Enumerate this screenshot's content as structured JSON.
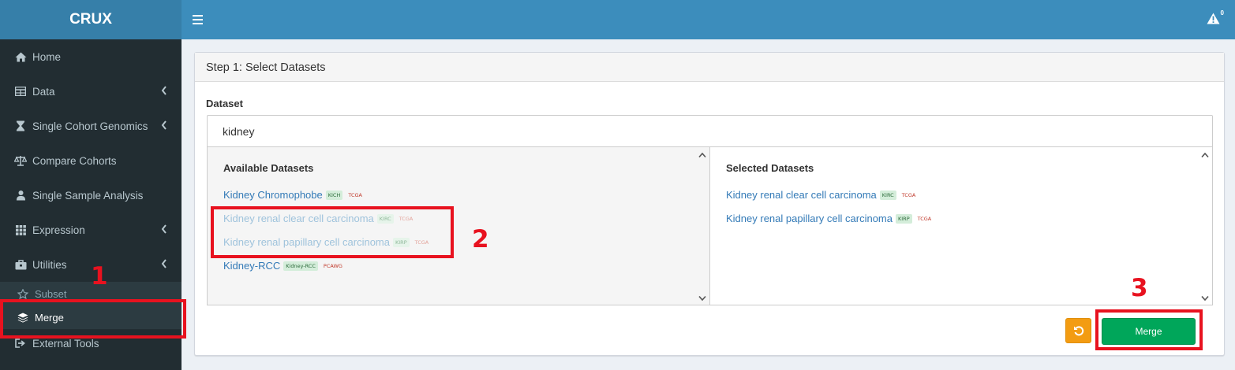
{
  "app": {
    "title": "CRUX",
    "alert_count": "0"
  },
  "sidebar": {
    "items": [
      {
        "label": "Home",
        "icon": "home-icon"
      },
      {
        "label": "Data",
        "icon": "table-icon"
      },
      {
        "label": "Single Cohort Genomics",
        "icon": "hourglass-icon"
      },
      {
        "label": "Compare Cohorts",
        "icon": "balance-scale-icon"
      },
      {
        "label": "Single Sample Analysis",
        "icon": "user-icon"
      },
      {
        "label": "Expression",
        "icon": "grid-icon"
      },
      {
        "label": "Utilities",
        "icon": "toolbox-icon"
      }
    ],
    "utilities_sub": [
      {
        "label": "Subset",
        "icon": "star-icon"
      },
      {
        "label": "Merge",
        "icon": "layers-icon"
      }
    ],
    "external": {
      "label": "External Tools",
      "icon": "sign-out-icon"
    }
  },
  "main": {
    "box_title": "Step 1: Select Datasets",
    "dataset_label": "Dataset",
    "search_value": "kidney",
    "available_title": "Available Datasets",
    "selected_title": "Selected Datasets",
    "available": [
      {
        "name": "Kidney Chromophobe",
        "code": "KICH",
        "source": "TCGA",
        "dimmed": false
      },
      {
        "name": "Kidney renal clear cell carcinoma",
        "code": "KIRC",
        "source": "TCGA",
        "dimmed": true
      },
      {
        "name": "Kidney renal papillary cell carcinoma",
        "code": "KIRP",
        "source": "TCGA",
        "dimmed": true
      },
      {
        "name": "Kidney-RCC",
        "code": "Kidney-RCC",
        "source": "PCAWG",
        "dimmed": false
      }
    ],
    "selected": [
      {
        "name": "Kidney renal clear cell carcinoma",
        "code": "KIRC",
        "source": "TCGA"
      },
      {
        "name": "Kidney renal papillary cell carcinoma",
        "code": "KIRP",
        "source": "TCGA"
      }
    ],
    "merge_label": "Merge"
  },
  "annotations": {
    "one": "1",
    "two": "2",
    "three": "3"
  },
  "colors": {
    "header": "#3c8dbc",
    "logo": "#367fa9",
    "sidebar": "#222d32",
    "merge": "#00a65a",
    "reset": "#f39c12",
    "highlight": "#e8121f"
  }
}
